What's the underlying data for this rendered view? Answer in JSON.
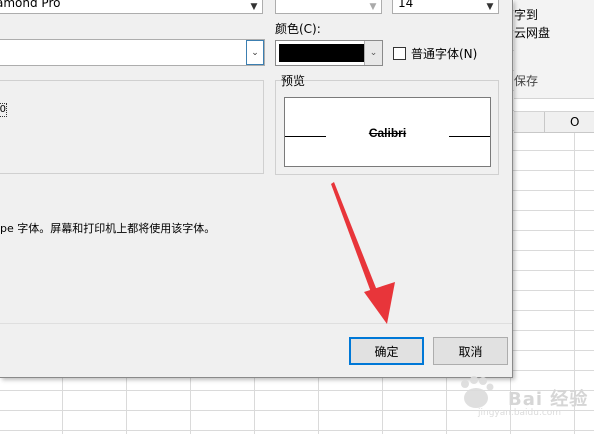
{
  "dialog": {
    "font_value": "amond Pro",
    "size_value": "14",
    "color_label": "颜色(C):",
    "normal_font_label": "普通字体(N)",
    "preview_label": "预览",
    "preview_text": "Calibri",
    "info_text": "pe 字体。屏幕和打印机上都将使用该字体。",
    "effects_mark": "0",
    "ok_label": "确定",
    "cancel_label": "取消",
    "color_value": "#000000"
  },
  "excel": {
    "ribbon_line1": "字到",
    "ribbon_line2": "云网盘",
    "ribbon_line3": "保存",
    "column_o": "O"
  },
  "watermark": {
    "text": "Bai 经验",
    "sub": "jingyan.baidu.com"
  },
  "icons": {
    "dropdown": "chevron-down-icon",
    "arrow": "red-arrow-annotation-icon"
  }
}
